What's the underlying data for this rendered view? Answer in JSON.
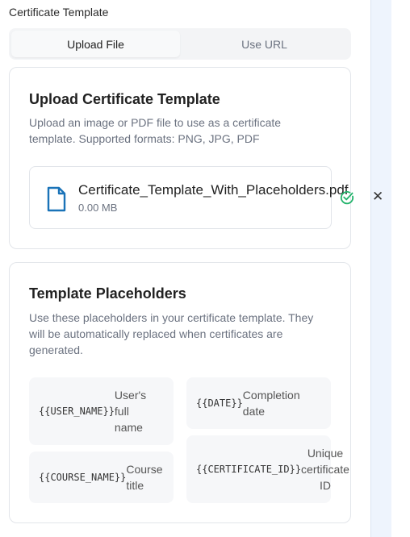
{
  "section_label": "Certificate Template",
  "tabs": [
    {
      "label": "Upload File",
      "active": true
    },
    {
      "label": "Use URL",
      "active": false
    }
  ],
  "upload_card": {
    "title": "Upload Certificate Template",
    "description": "Upload an image or PDF file to use as a certificate template. Supported formats: PNG, JPG, PDF",
    "file": {
      "name": "Certificate_Template_With_Placeholders.pdf",
      "size": "0.00 MB",
      "icon": "file-icon",
      "status_icon": "check-circle-icon",
      "remove_icon": "close-icon"
    }
  },
  "placeholders_card": {
    "title": "Template Placeholders",
    "description": "Use these placeholders in your certificate template. They will be automatically replaced when certificates are generated.",
    "items": [
      {
        "code": "{{USER_NAME}}",
        "label": "User's full name"
      },
      {
        "code": "{{DATE}}",
        "label": "Completion date"
      },
      {
        "code": "{{COURSE_NAME}}",
        "label": "Course title"
      },
      {
        "code": "{{CERTIFICATE_ID}}",
        "label": "Unique certificate ID"
      }
    ]
  },
  "colors": {
    "accent": "#1a73b8",
    "success": "#22b36b",
    "muted_text": "#6b7280",
    "side_panel": "#eef4fd"
  }
}
